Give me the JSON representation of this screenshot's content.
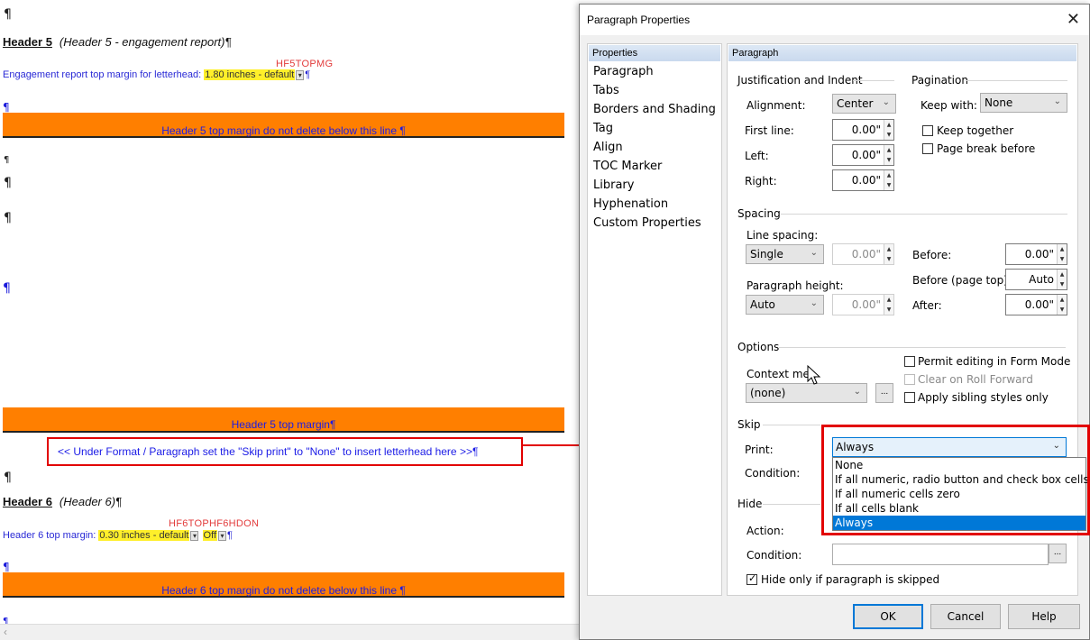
{
  "document": {
    "pilcrow": "¶",
    "header5": {
      "label": "Header 5",
      "desc": "(Header 5 - engagement report)¶"
    },
    "hf5_tag": "HF5TOPMG",
    "engagement_line": {
      "text": "Engagement report top margin for letterhead:",
      "value": "1.80 inches - default",
      "tail": "¶"
    },
    "band1": "Header 5 top margin do not delete below this line ¶",
    "band2": "Header 5 top margin¶",
    "instruction": "<< Under Format / Paragraph set the \"Skip print\" to \"None\" to insert letterhead here >>¶",
    "header6": {
      "label": "Header 6",
      "desc": "(Header 6)¶"
    },
    "hf6_tags": "HF6TOPHF6HDON",
    "header6_line": {
      "text": "Header 6  top margin:",
      "value": "0.30 inches - default",
      "off": "Off",
      "tail": "¶"
    },
    "band3": "Header 6 top margin do not delete below this line ¶"
  },
  "dialog": {
    "title": "Paragraph Properties",
    "left_header": "Properties",
    "left_items": [
      "Paragraph",
      "Tabs",
      "Borders and Shading",
      "Tag",
      "Align",
      "TOC Marker",
      "Library",
      "Hyphenation",
      "Custom Properties"
    ],
    "right_header": "Paragraph",
    "justification": {
      "group": "Justification and Indent",
      "alignment_label": "Alignment:",
      "alignment_value": "Center",
      "first_line_label": "First line:",
      "first_line_value": "0.00\"",
      "left_label": "Left:",
      "left_value": "0.00\"",
      "right_label": "Right:",
      "right_value": "0.00\""
    },
    "pagination": {
      "group": "Pagination",
      "keep_with_label": "Keep with:",
      "keep_with_value": "None",
      "keep_together": "Keep together",
      "page_break_before": "Page break before"
    },
    "spacing": {
      "group": "Spacing",
      "line_spacing_label": "Line spacing:",
      "line_spacing_value": "Single",
      "line_spacing_num": "0.00\"",
      "paragraph_height_label": "Paragraph height:",
      "paragraph_height_value": "Auto",
      "paragraph_height_num": "0.00\"",
      "before_label": "Before:",
      "before_value": "0.00\"",
      "before_top_label": "Before (page top):",
      "before_top_value": "Auto",
      "after_label": "After:",
      "after_value": "0.00\""
    },
    "options": {
      "group": "Options",
      "context_menu_label": "Context men",
      "context_menu_value": "(none)",
      "dots": "...",
      "permit_editing": "Permit editing in Form Mode",
      "clear_roll_forward": "Clear on Roll Forward",
      "apply_sibling": "Apply sibling styles only"
    },
    "skip": {
      "group": "Skip",
      "print_label": "Print:",
      "print_value": "Always",
      "condition_label": "Condition:",
      "options": [
        "None",
        "If all numeric, radio button and check box cells zero",
        "If all numeric cells zero",
        "If all cells blank",
        "Always"
      ],
      "selected_index": 4
    },
    "hide": {
      "group": "Hide",
      "action_label": "Action:",
      "condition_label": "Condition:",
      "dots": "...",
      "hide_only_if_skipped": "Hide only if paragraph is skipped"
    },
    "buttons": {
      "ok": "OK",
      "cancel": "Cancel",
      "help": "Help"
    },
    "close_glyph": "✕"
  },
  "colors": {
    "orange_band": "#ff7f00",
    "annotation_red": "#e20000",
    "selection_blue": "#0078d7",
    "field_yellow": "#ffef2a"
  }
}
